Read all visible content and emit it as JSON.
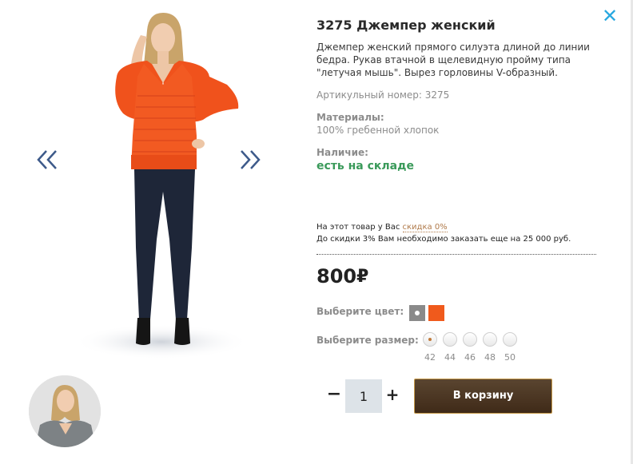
{
  "product": {
    "title": "3275 Джемпер женский",
    "description": "Джемпер женский прямого силуэта длиной до линии бедра. Рукав втачной в щелевидную пройму типа \"летучая мышь\". Вырез горловины V-образный.",
    "article": "Артикульный номер: 3275",
    "materials_label": "Материалы:",
    "materials_value": "100% гребенной хлопок",
    "stock_label": "Наличие:",
    "stock_value": "есть на складе"
  },
  "discount": {
    "line1_prefix": "На этот товар у Вас ",
    "line1_link": "скидка 0%",
    "line2": "До скидки 3% Вам необходимо заказать еще на 25 000 руб."
  },
  "price": {
    "value": "800",
    "currency": "₽"
  },
  "color": {
    "label": "Выберите цвет:",
    "options": [
      {
        "name": "gray",
        "hex": "#8a8a8a",
        "selected": true
      },
      {
        "name": "orange",
        "hex": "#f05a1c",
        "selected": false
      }
    ]
  },
  "size": {
    "label": "Выберите размер:",
    "options": [
      "42",
      "44",
      "46",
      "48",
      "50"
    ],
    "selected": "42"
  },
  "cart": {
    "quantity": "1",
    "minus": "−",
    "plus": "+",
    "button_label": "В корзину"
  },
  "icons": {
    "close": "close-icon",
    "prev": "chevron-double-left-icon",
    "next": "chevron-double-right-icon"
  },
  "colors": {
    "accent_blue": "#28a8e0",
    "stock_green": "#3a9a5a",
    "button_brown": "#4a3520",
    "arrow": "#3d5a8a"
  }
}
